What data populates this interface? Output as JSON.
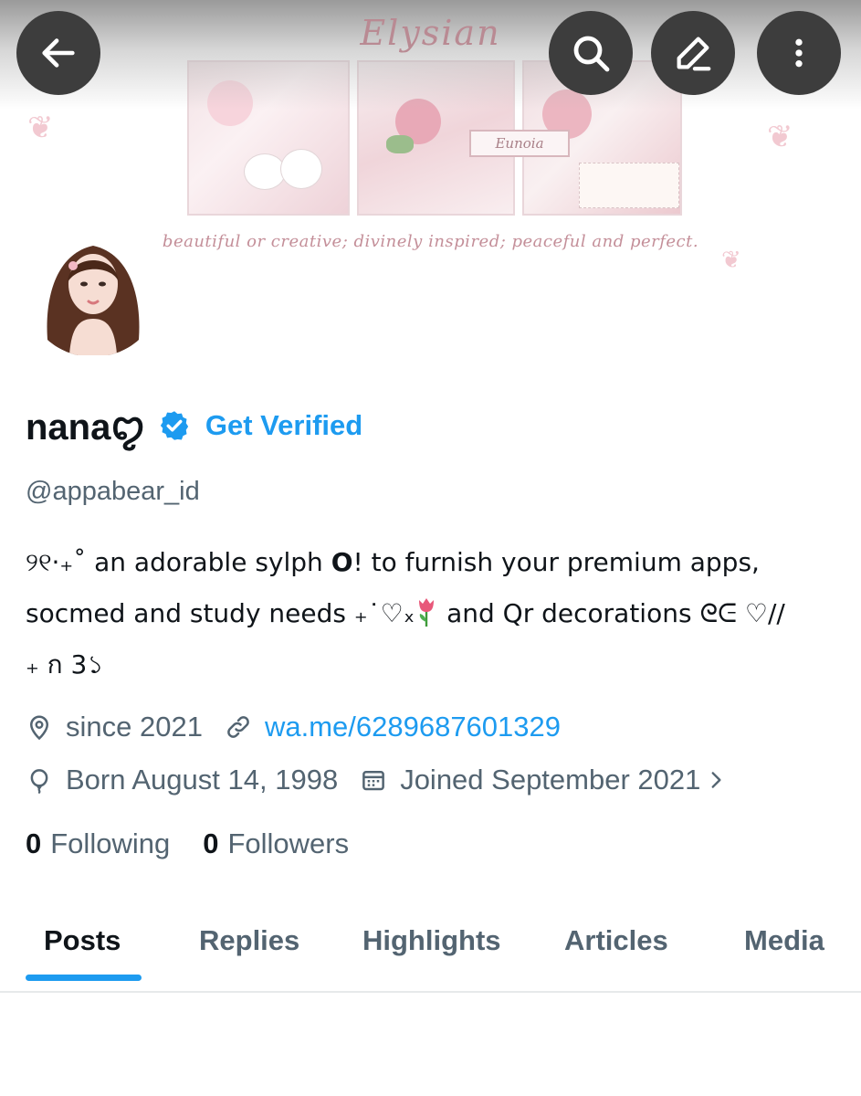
{
  "banner": {
    "title": "Elysian",
    "label": "Eunoia",
    "tagline": "beautiful or creative;  divinely inspired;  peaceful and perfect."
  },
  "toolbar": {
    "back_icon": "arrow-left-icon",
    "search_icon": "search-icon",
    "edit_icon": "pencil-icon",
    "more_icon": "more-vertical-icon"
  },
  "profile": {
    "display_name": "nanaꨄ",
    "get_verified_label": "Get Verified",
    "handle": "@appabear_id",
    "bio": {
      "line1_prefix": "୨୧·₊˚ an adorable sylph ",
      "line1_bold": "O",
      "line1_suffix": "! to furnish your premium apps,",
      "line2_prefix": "socmed and study needs ₊˙♡ₓ",
      "line2_suffix": " and Qr decorations ᘓᕮ ♡//",
      "line3": "₊ ก 3১"
    },
    "location": "since 2021",
    "link": "wa.me/6289687601329",
    "birthday": "Born August 14, 1998",
    "joined": "Joined September 2021",
    "following_count": "0",
    "following_label": "Following",
    "followers_count": "0",
    "followers_label": "Followers"
  },
  "tabs": [
    {
      "label": "Posts",
      "active": true
    },
    {
      "label": "Replies",
      "active": false
    },
    {
      "label": "Highlights",
      "active": false
    },
    {
      "label": "Articles",
      "active": false
    },
    {
      "label": "Media",
      "active": false
    }
  ],
  "colors": {
    "accent": "#1d9bf0",
    "text_primary": "#0f1419",
    "text_secondary": "#536471",
    "overlay_button": "#3d3d3d"
  }
}
